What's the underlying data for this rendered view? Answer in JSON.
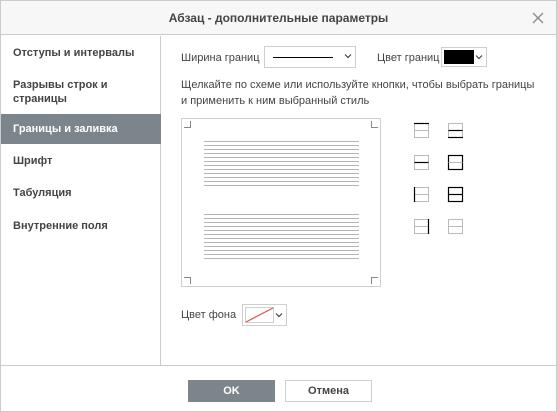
{
  "dialog": {
    "title": "Абзац - дополнительные параметры"
  },
  "sidebar": {
    "items": [
      {
        "label": "Отступы и интервалы",
        "active": false
      },
      {
        "label": "Разрывы строк и страницы",
        "active": false
      },
      {
        "label": "Границы и заливка",
        "active": true
      },
      {
        "label": "Шрифт",
        "active": false
      },
      {
        "label": "Табуляция",
        "active": false
      },
      {
        "label": "Внутренние поля",
        "active": false
      }
    ]
  },
  "borders": {
    "width_label": "Ширина границ",
    "color_label": "Цвет границ",
    "color_value": "#000000",
    "hint": "Щелкайте по схеме или используйте кнопки, чтобы выбрать границы и применить к ним выбранный стиль",
    "background_label": "Цвет фона",
    "background_value": "none"
  },
  "footer": {
    "ok_label": "OK",
    "cancel_label": "Отмена"
  },
  "colors": {
    "accent": "#7d858c",
    "border": "#cbcbcb",
    "no_fill_slash": "#d9534f"
  },
  "icons": {
    "border_buttons": [
      "border-top-icon",
      "border-outer-all-icon",
      "border-bottom-icon",
      "border-inner-horizontal-icon",
      "border-left-icon",
      "border-all-icon",
      "border-right-icon",
      "border-none-icon"
    ]
  }
}
